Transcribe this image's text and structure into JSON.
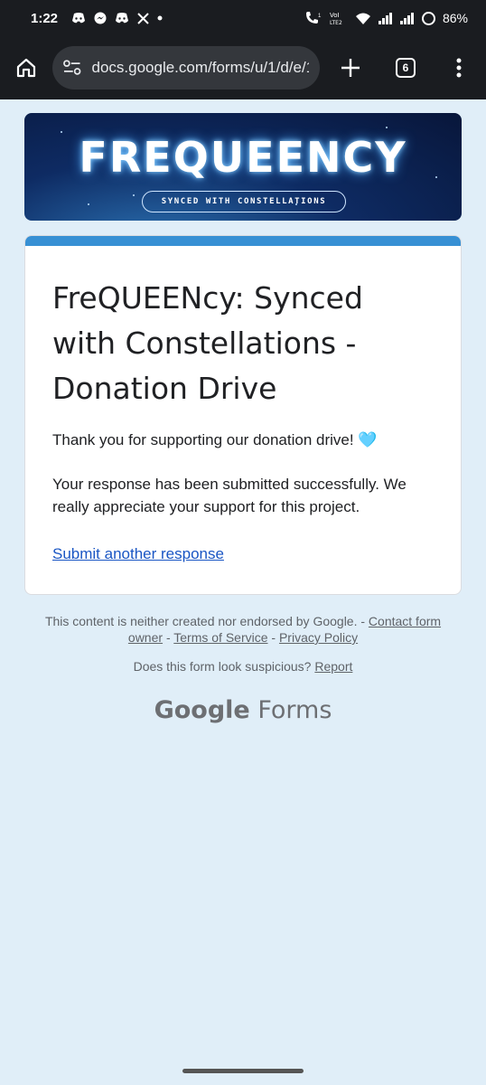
{
  "status_bar": {
    "time": "1:22",
    "battery": "86%",
    "icons": [
      "discord-icon",
      "messenger-icon",
      "discord-icon",
      "x-icon",
      "dot-icon",
      "call-icon",
      "wifi-icon",
      "signal-icon",
      "signal-icon",
      "battery-icon"
    ]
  },
  "browser": {
    "url": "docs.google.com/forms/u/1/d/e/1",
    "tab_count": "6"
  },
  "banner": {
    "title": "FREQUEENCY",
    "subtitle": "SYNCED WITH CONSTELLATIONS"
  },
  "form": {
    "title": "FreQUEENcy: Synced with Constellations - Donation Drive",
    "thanks": "Thank you for supporting our donation drive! 🩵",
    "confirmation": "Your response has been submitted successfully. We really appreciate your support for this project.",
    "submit_another": "Submit another response"
  },
  "footer": {
    "disclaimer": "This content is neither created nor endorsed by Google. -",
    "contact_owner": "Contact form owner",
    "sep1": "-",
    "terms": "Terms of Service",
    "sep2": "-",
    "privacy": "Privacy Policy",
    "suspicious": "Does this form look suspicious?",
    "report": "Report",
    "logo_google": "Google",
    "logo_forms": "Forms"
  },
  "colors": {
    "accent": "#3790d4",
    "background": "#e0eef8",
    "link": "#1a56c4"
  }
}
